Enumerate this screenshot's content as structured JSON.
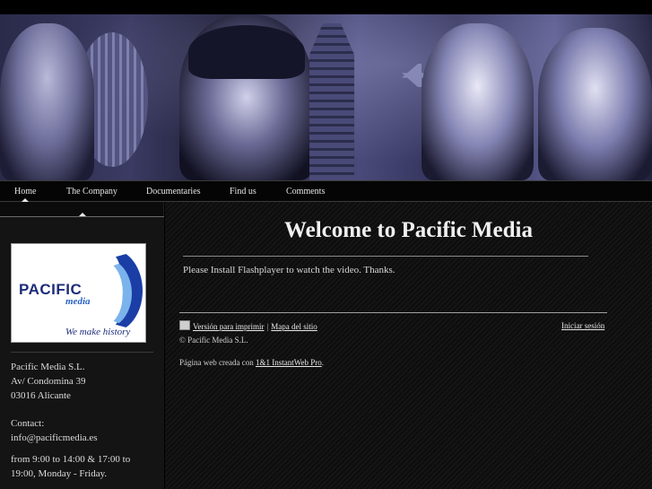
{
  "nav": {
    "items": [
      "Home",
      "The Company",
      "Documentaries",
      "Find us",
      "Comments"
    ],
    "active": "Home"
  },
  "sidebar": {
    "logo": {
      "brand": "PACIFIC",
      "sub": "media",
      "slogan": "We make history"
    },
    "address": [
      "Pacific Media S.L.",
      "Av/ Condomina 39",
      "03016 Alicante"
    ],
    "contact_label": "Contact:",
    "contact_email": "info@pacificmedia.es",
    "hours": [
      "from 9:00 to 14:00 & 17:00 to",
      "19:00, Monday - Friday."
    ]
  },
  "main": {
    "title": "Welcome to Pacific Media",
    "message": "Please Install Flashplayer to watch the video. Thanks."
  },
  "footer": {
    "print_label": "Versión para imprimir",
    "sitemap_label": "Mapa del sitio",
    "separator": "|",
    "login_label": "Iniciar sesión",
    "copyright": "© Pacific Media S.L.",
    "created_prefix": "Página web creada con",
    "created_link": "1&1 InstantWeb Pro",
    "created_suffix": "."
  },
  "colors": {
    "background": "#000000",
    "text": "#d8d8d8",
    "logo_blue": "#1d2c7a"
  }
}
